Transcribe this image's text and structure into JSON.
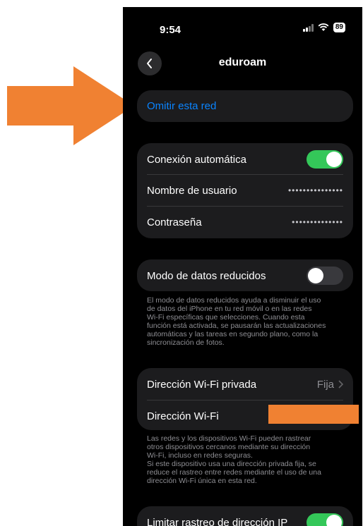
{
  "status_bar": {
    "time": "9:54",
    "battery": "89"
  },
  "nav": {
    "title": "eduroam"
  },
  "forget": {
    "label": "Omitir esta red"
  },
  "auto_join": {
    "label": "Conexión automática",
    "on": true
  },
  "username": {
    "label": "Nombre de usuario",
    "value": "•••••••••••••••"
  },
  "password": {
    "label": "Contraseña",
    "value": "••••••••••••••"
  },
  "low_data": {
    "label": "Modo de datos reducidos",
    "on": false,
    "footnote": [
      "El modo de datos reducidos ayuda a disminuir el uso",
      "de datos del iPhone en tu red móvil o en las redes",
      "Wi-Fi específicas que selecciones. Cuando esta",
      "función está activada, se pausarán las actualizaciones",
      "automáticas y las tareas en segundo plano, como la",
      "sincronización de fotos."
    ]
  },
  "private_address": {
    "label": "Dirección Wi-Fi privada",
    "value": "Fija"
  },
  "wifi_address": {
    "label": "Dirección Wi-Fi"
  },
  "private_footnote": [
    "Las redes y los dispositivos Wi-Fi pueden rastrear",
    "otros dispositivos cercanos mediante su dirección",
    "Wi-Fi, incluso en redes seguras.",
    "Si este dispositivo usa una dirección privada fija, se",
    "reduce el rastreo entre redes mediante el uso de una",
    "dirección Wi-Fi única en esta red."
  ],
  "limit_ip": {
    "label": "Limitar rastreo de dirección IP",
    "on": true
  },
  "colors": {
    "accent_blue": "#0a84ff",
    "toggle_green": "#34c759",
    "arrow_orange": "#f08132",
    "cell_bg": "#1c1c1e"
  }
}
